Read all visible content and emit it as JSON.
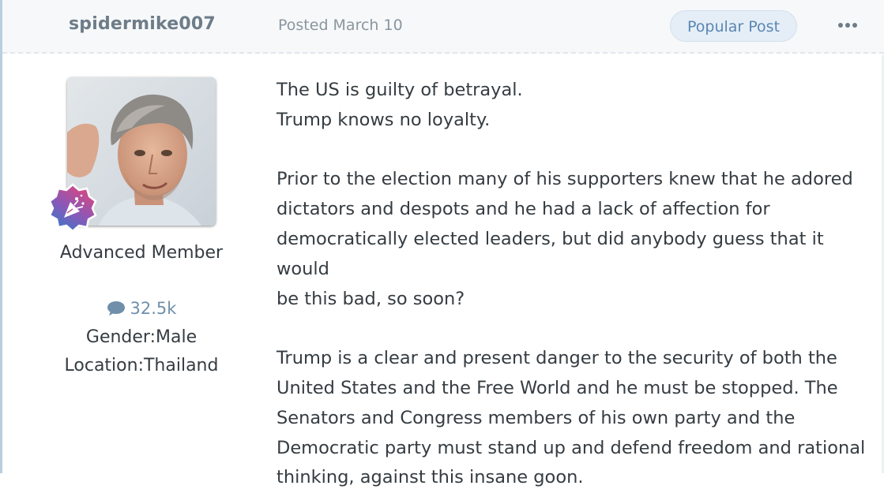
{
  "post": {
    "author": "spidermike007",
    "date": "Posted March 10",
    "badge": "Popular Post",
    "more_icon": "ellipsis-icon"
  },
  "author_pane": {
    "member_title": "Advanced Member",
    "posts_count": "32.5k",
    "posts_icon": "speech-bubble-icon",
    "gender": "Gender:Male",
    "location": "Location:Thailand"
  },
  "content": {
    "lines": [
      "The US is guilty of betrayal.",
      "Trump knows no loyalty.",
      "",
      "Prior to the election many of his supporters knew that he adored",
      "dictators and despots and he had a lack of affection for",
      "democratically elected leaders, but did anybody guess that it would",
      "be this bad, so soon?",
      "",
      "Trump is a clear and present danger to the security of both the",
      "United States and the Free World and he must be stopped. The",
      "Senators and Congress members of his own party and the",
      "Democratic party must stand up and defend freedom and rational",
      "thinking, against this insane goon."
    ]
  },
  "colors": {
    "header_bg": "#f6f8fa",
    "badge_bg": "#e5eef7",
    "badge_text": "#5a86b3",
    "author_text": "#6d7c88",
    "body_text": "#353c41",
    "rank_badge_top": "#e0457b",
    "rank_badge_bottom": "#3a78c8"
  }
}
